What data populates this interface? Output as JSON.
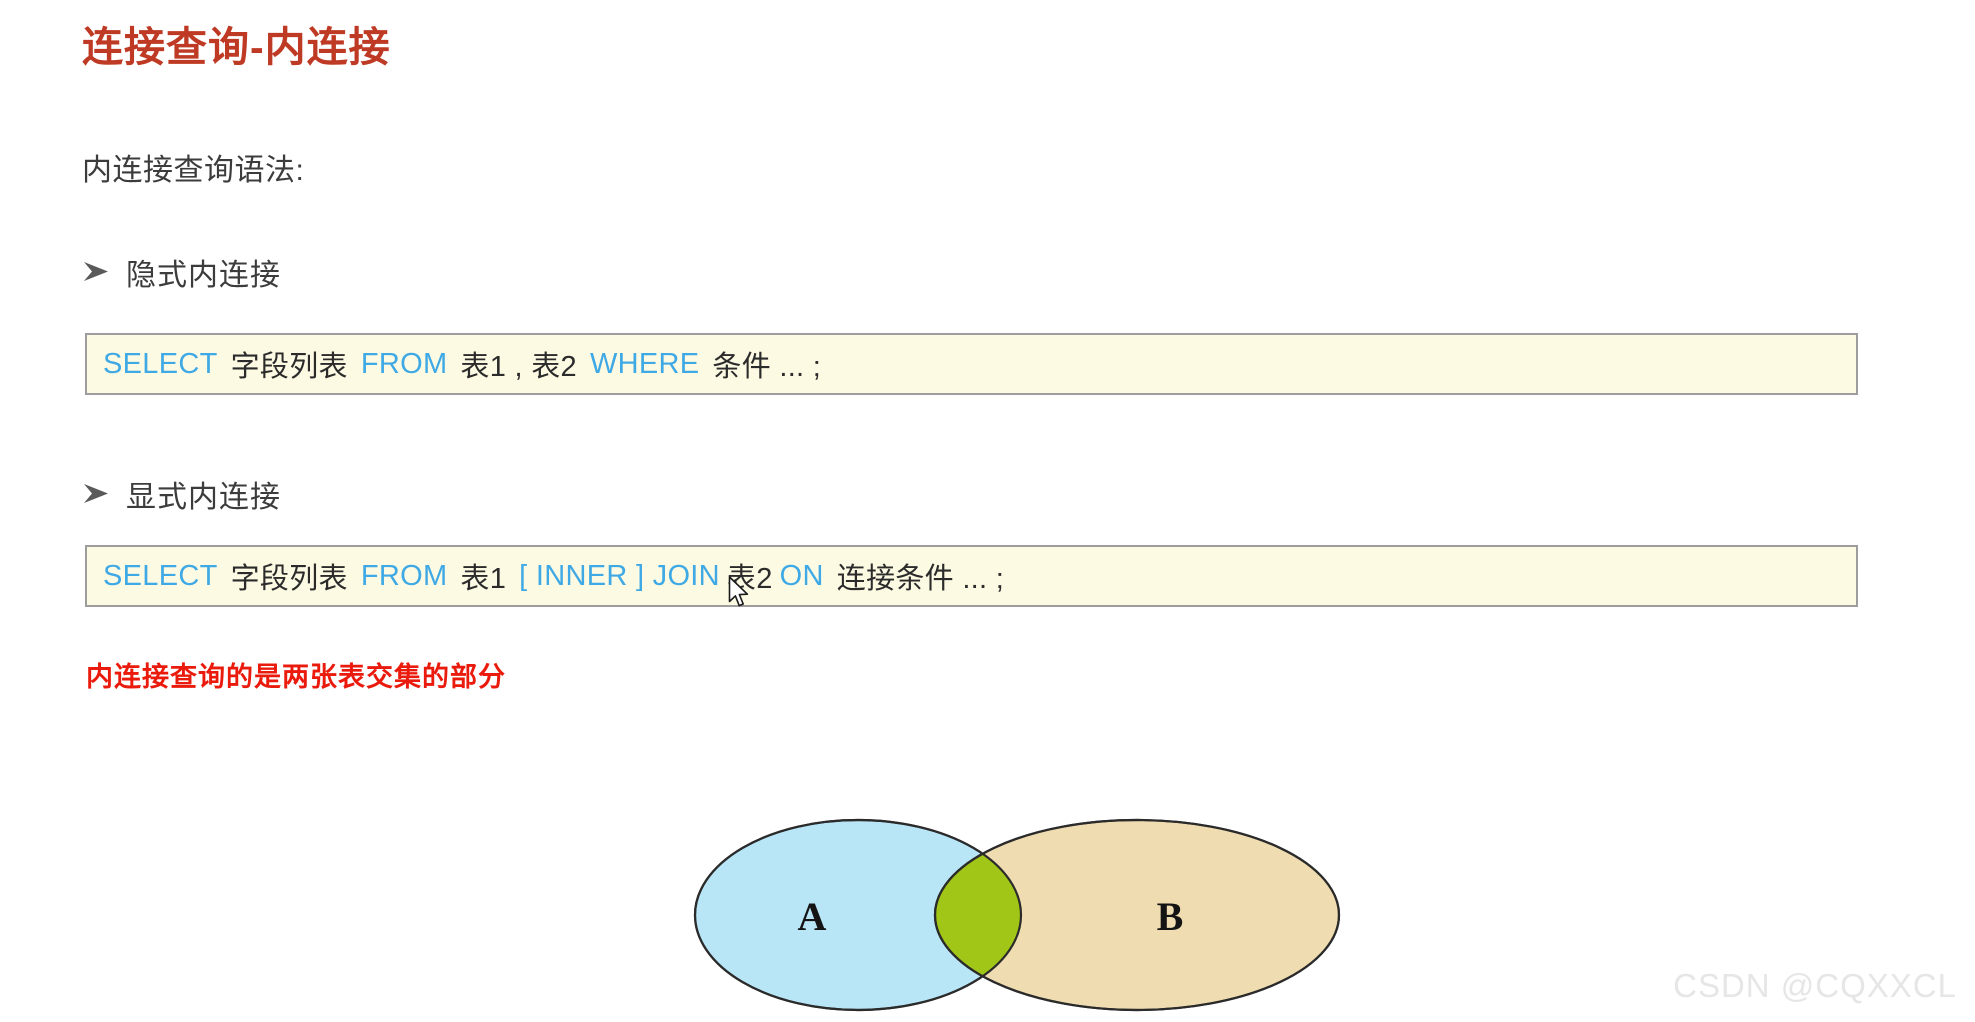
{
  "slide": {
    "title": "连接查询-内连接",
    "title_color": "#bf3a24",
    "intro": "内连接查询语法:",
    "background": "#ffffff"
  },
  "sections": [
    {
      "bullet_icon": "arrow-bullet-icon",
      "label": "隐式内连接",
      "code": {
        "tokens": [
          {
            "text": "SELECT",
            "kind": "keyword"
          },
          {
            "text": "字段列表",
            "kind": "plain"
          },
          {
            "text": "FROM",
            "kind": "keyword"
          },
          {
            "text": "表1 , 表2",
            "kind": "plain"
          },
          {
            "text": "WHERE",
            "kind": "keyword"
          },
          {
            "text": "条件 ... ;",
            "kind": "plain"
          }
        ],
        "plain_text": "SELECT 字段列表  FROM  表1 , 表2  WHERE  条件 ... ;"
      }
    },
    {
      "bullet_icon": "arrow-bullet-icon",
      "label": "显式内连接",
      "code": {
        "tokens": [
          {
            "text": "SELECT",
            "kind": "keyword"
          },
          {
            "text": "字段列表",
            "kind": "plain"
          },
          {
            "text": "FROM",
            "kind": "keyword"
          },
          {
            "text": "表1",
            "kind": "plain"
          },
          {
            "text": "[ INNER ] JOIN",
            "kind": "keyword"
          },
          {
            "text": "表2",
            "kind": "plain"
          },
          {
            "text": "ON",
            "kind": "keyword"
          },
          {
            "text": "连接条件 ... ;",
            "kind": "plain"
          }
        ],
        "plain_text": "SELECT 字段列表  FROM  表1 [ INNER ] JOIN 表2  ON  连接条件 ... ;"
      }
    }
  ],
  "note": {
    "text": "内连接查询的是两张表交集的部分",
    "color": "#ea1b0c"
  },
  "venn": {
    "left_label": "A",
    "right_label": "B",
    "left_fill": "#b9e6f7",
    "right_fill": "#efdcb0",
    "intersection_fill": "#a2c617",
    "stroke": "#2b2b2b"
  },
  "code_style": {
    "background": "#fdfae3",
    "border": "#9d9d9d",
    "keyword_color": "#3fa9e5",
    "text_color": "#2b2b2b"
  },
  "cursor": {
    "type": "arrow-pointer"
  },
  "watermark": {
    "text": "CSDN @CQXXCL",
    "color": "#e6e6e6"
  }
}
